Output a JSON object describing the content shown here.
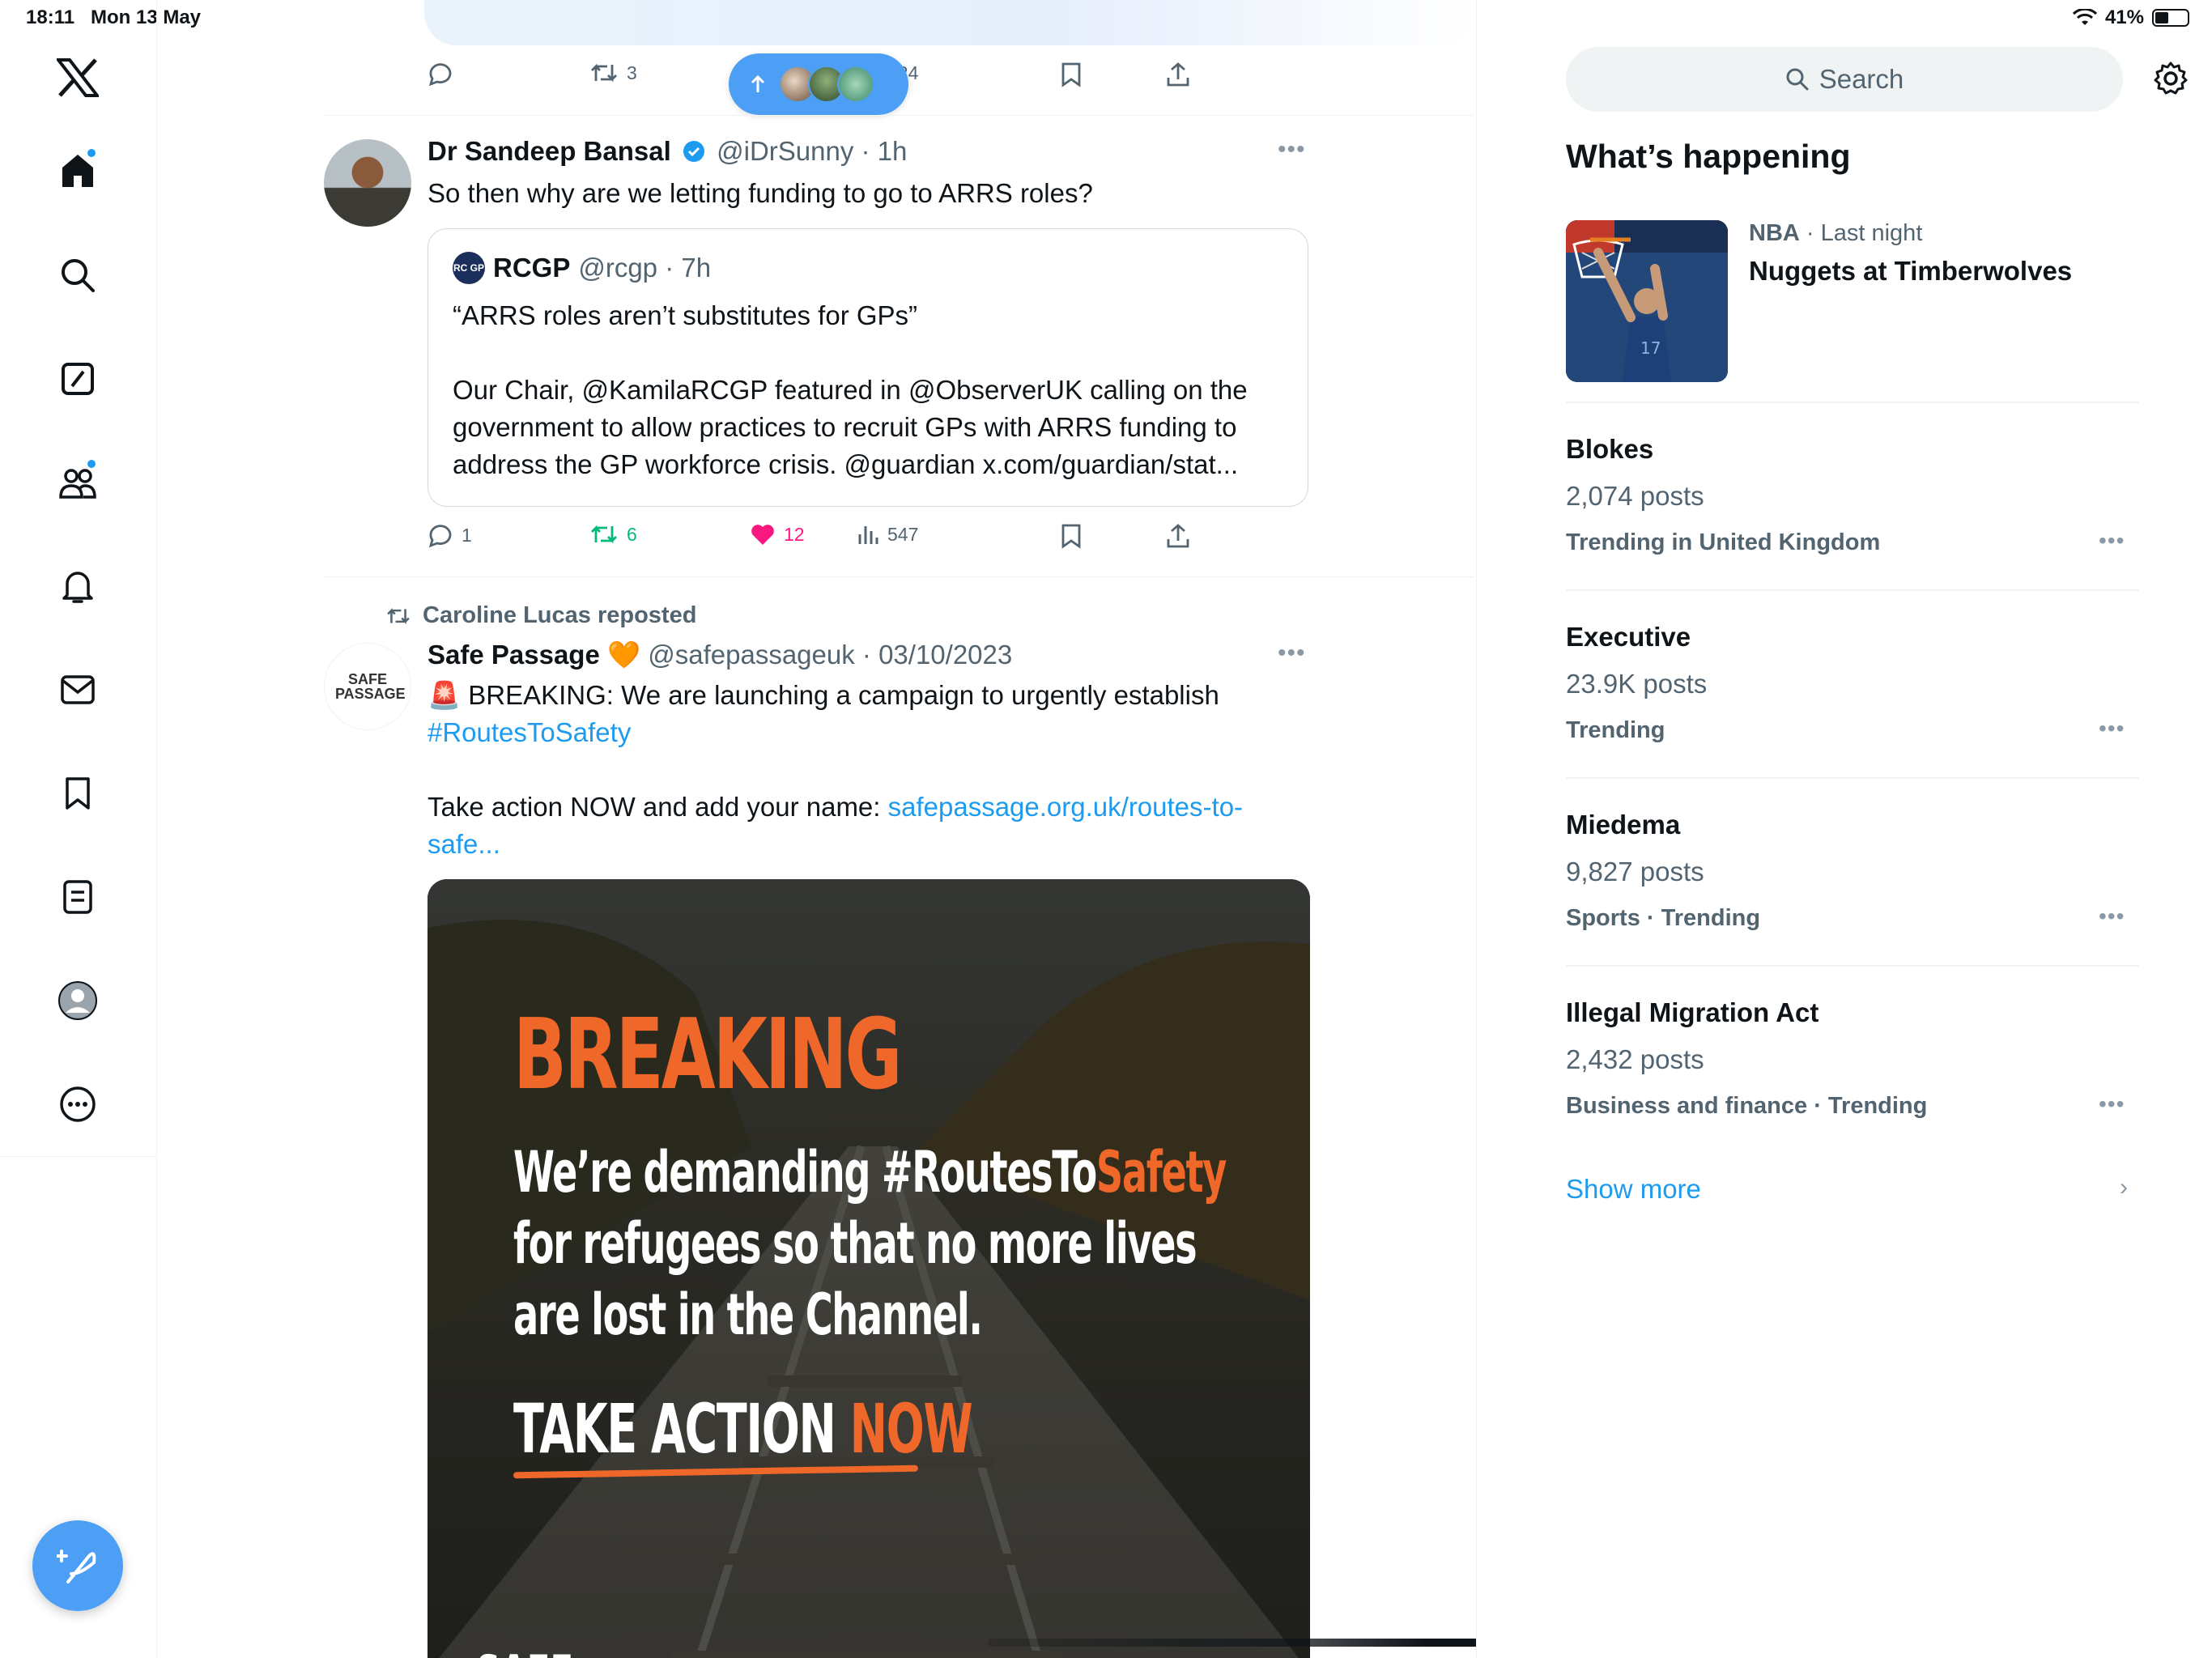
{
  "status_bar": {
    "time": "18:11",
    "date": "Mon 13 May",
    "battery": "41%",
    "battery_level": 0.41
  },
  "nav": {
    "items": [
      "x-logo",
      "home",
      "search",
      "grok",
      "communities",
      "notifications",
      "messages",
      "bookmarks",
      "lists",
      "profile",
      "more"
    ],
    "compose_label": "Post"
  },
  "feed": {
    "prev_post_actions": {
      "replies": "",
      "reposts": "3",
      "views": "824"
    },
    "tweet1": {
      "name": "Dr Sandeep Bansal",
      "verified": true,
      "handle_time": "@iDrSunny · 1h",
      "text": "So then why are we letting funding to go to ARRS roles?",
      "quote": {
        "logo_text": "RC GP",
        "name": "RCGP",
        "handle_time": "@rcgp · 7h",
        "line1": "“ARRS roles aren’t substitutes for GPs”",
        "line2": "Our Chair, @KamilaRCGP featured in @ObserverUK calling on the government to allow practices to recruit GPs with ARRS funding to address the GP workforce crisis. @guardian x.com/guardian/stat..."
      },
      "actions": {
        "replies": "1",
        "reposts": "6",
        "likes": "12",
        "views": "547"
      }
    },
    "tweet2": {
      "repost_by": "Caroline Lucas reposted",
      "avatar_text": "SAFE PASSAGE",
      "name": "Safe Passage",
      "emoji": "🧡",
      "handle_time": "@safepassageuk · 03/10/2023",
      "siren": "🚨",
      "text_main": "BREAKING: We are launching a campaign to urgently establish",
      "hashtag": "#RoutesToSafety",
      "text_action": "Take action NOW and add your name: ",
      "link": "safepassage.org.uk/routes-to-safe...",
      "media": {
        "title": "BREAKING",
        "body_pre": "We’re demanding #RoutesTo",
        "body_hl": "Safety",
        "body_post": " for refugees so that no more lives are lost in the Channel.",
        "cta_pre": "TAKE ACTION ",
        "cta_now": "NOW",
        "bottom": "SAFE"
      }
    }
  },
  "sidebar": {
    "search_placeholder": "Search",
    "heading": "What’s happening",
    "featured": {
      "category": "NBA",
      "time": " · Last night",
      "title": "Nuggets at Timberwolves"
    },
    "trends": [
      {
        "name": "Blokes",
        "posts": "2,074 posts",
        "category": "Trending in United Kingdom"
      },
      {
        "name": "Executive",
        "posts": "23.9K posts",
        "category": "Trending"
      },
      {
        "name": "Miedema",
        "posts": "9,827 posts",
        "category": "Sports · Trending"
      },
      {
        "name": "Illegal Migration Act",
        "posts": "2,432 posts",
        "category": "Business and finance · Trending"
      }
    ],
    "show_more": "Show more"
  },
  "colors": {
    "accent": "#1d9bf0",
    "like": "#f91880",
    "repost_active": "#00ba7c",
    "brand_orange": "#f0672a"
  }
}
